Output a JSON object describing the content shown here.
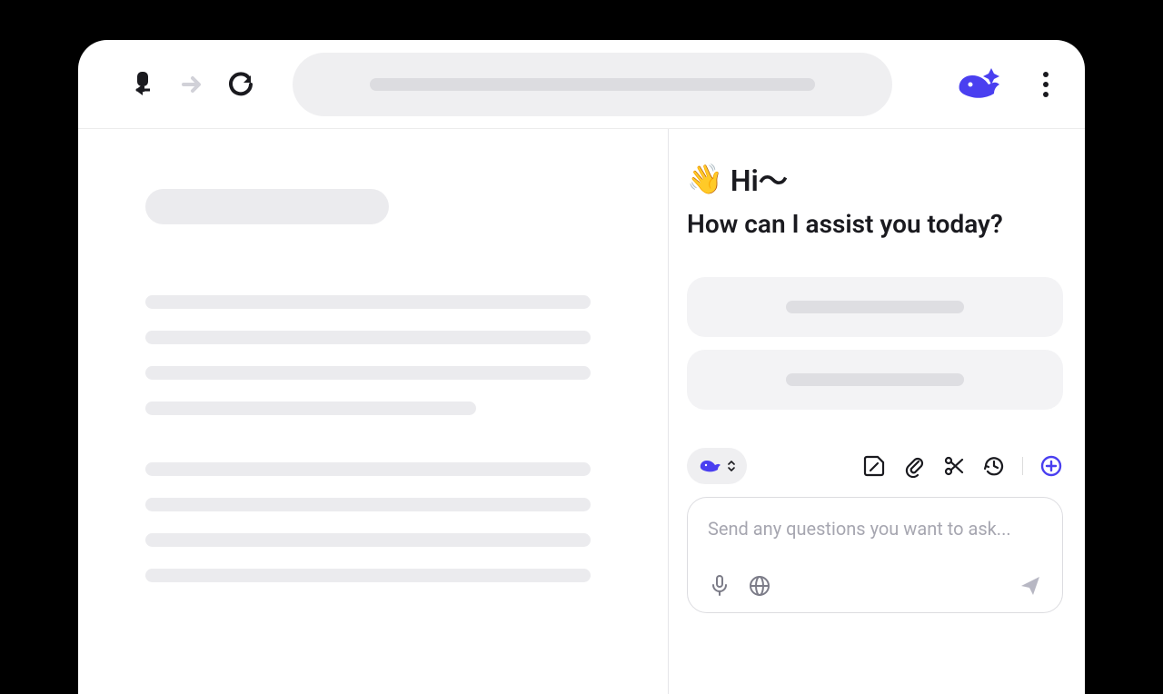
{
  "toolbar": {
    "back_icon": "back-icon",
    "forward_icon": "forward-icon",
    "reload_icon": "reload-icon",
    "brand_icon": "whale-icon",
    "menu_icon": "more-vertical-icon"
  },
  "assistant": {
    "greeting_wave": "👋",
    "greeting_text": "Hi～",
    "subtitle": "How can I assist you today?",
    "input_placeholder": "Send any questions you want to ask...",
    "model_chip_icon": "whale-icon",
    "action_icons": {
      "sticker": "sticker-icon",
      "attach": "attachment-icon",
      "scissors": "scissors-icon",
      "history": "history-icon",
      "new_chat": "plus-circle-icon"
    },
    "input_icons": {
      "voice": "microphone-icon",
      "web": "globe-icon",
      "send": "send-icon"
    }
  }
}
